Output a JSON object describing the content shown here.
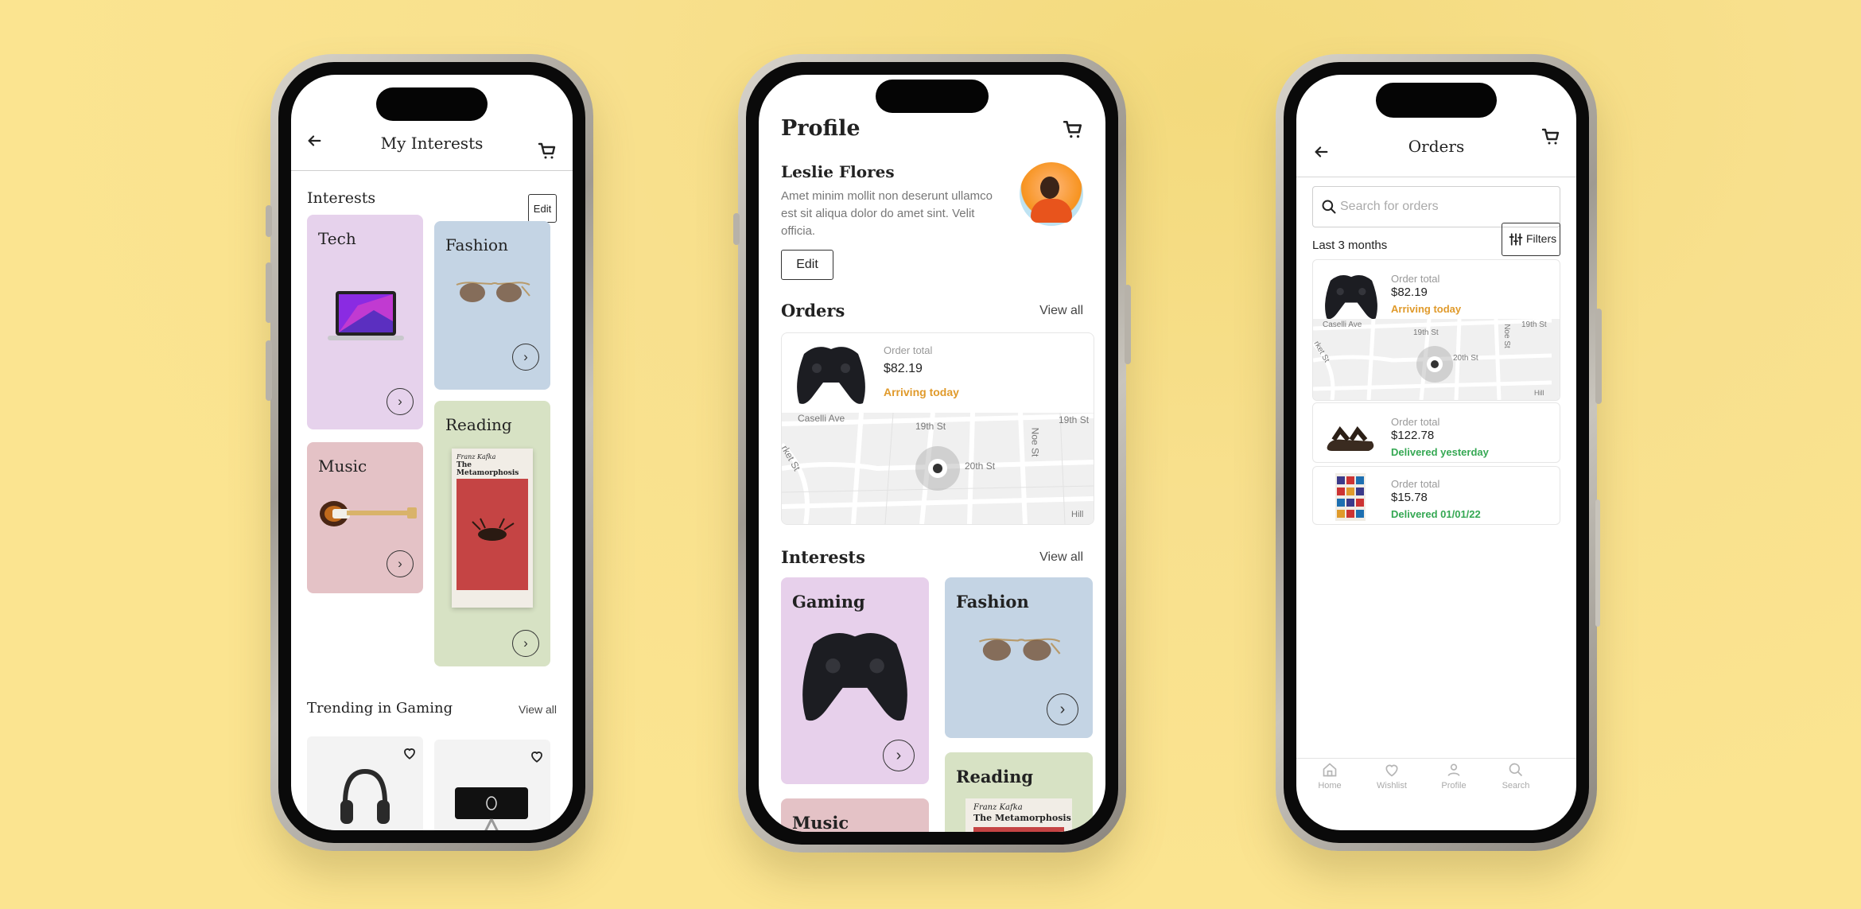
{
  "colors": {
    "background": "#fbe490",
    "accent_orange": "#e09a2b",
    "accent_green": "#35a853",
    "tech": "#e6d2ec",
    "fashion": "#c4d4e4",
    "reading": "#d7e2c4",
    "music": "#e4c2c6",
    "gaming": "#e7d0eb"
  },
  "interests_screen": {
    "title": "My Interests",
    "section": "Interests",
    "edit_label": "Edit",
    "tiles": [
      {
        "label": "Tech"
      },
      {
        "label": "Fashion"
      },
      {
        "label": "Music"
      },
      {
        "label": "Reading"
      }
    ],
    "book_author": "Franz Kafka",
    "book_title": "The Metamorphosis",
    "trending_title": "Trending in Gaming",
    "view_all": "View all"
  },
  "profile_screen": {
    "title": "Profile",
    "name": "Leslie Flores",
    "bio": "Amet minim mollit non deserunt ullamco est sit aliqua dolor do amet sint. Velit officia.",
    "edit_label": "Edit",
    "orders_title": "Orders",
    "view_all": "View all",
    "order": {
      "label": "Order total",
      "amount": "$82.19",
      "status": "Arriving today"
    },
    "map_labels": [
      "Caselli Ave",
      "19th St",
      "19th St",
      "Noe St",
      "20th St",
      "rket St",
      "Hill"
    ],
    "interests_title": "Interests",
    "tiles": [
      {
        "label": "Gaming"
      },
      {
        "label": "Fashion"
      },
      {
        "label": "Reading"
      },
      {
        "label": "Music"
      }
    ],
    "book_author": "Franz Kafka",
    "book_title": "The Metamorphosis"
  },
  "orders_screen": {
    "title": "Orders",
    "search_placeholder": "Search for orders",
    "period": "Last 3 months",
    "filters_label": "Filters",
    "orders": [
      {
        "label": "Order total",
        "amount": "$82.19",
        "status": "Arriving today"
      },
      {
        "label": "Order total",
        "amount": "$122.78",
        "status": "Delivered yesterday"
      },
      {
        "label": "Order total",
        "amount": "$15.78",
        "status": "Delivered 01/01/22"
      }
    ],
    "map_labels": [
      "Caselli Ave",
      "19th St",
      "19th St",
      "Noe St",
      "20th St",
      "rket St",
      "Hill"
    ],
    "tabs": [
      {
        "label": "Home"
      },
      {
        "label": "Wishlist"
      },
      {
        "label": "Profile"
      },
      {
        "label": "Search"
      }
    ]
  }
}
